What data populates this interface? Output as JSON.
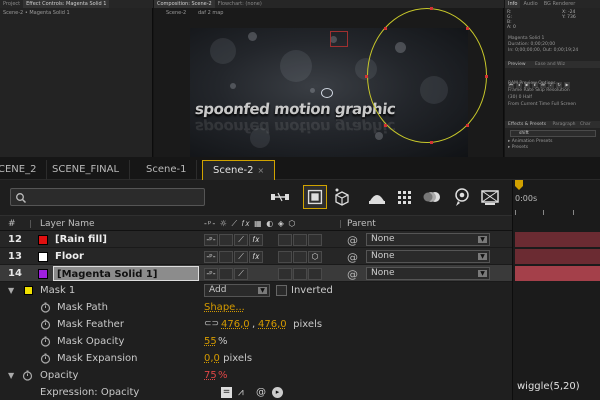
{
  "top": {
    "left_tabs": [
      "Project",
      "Effect Controls: Magenta Solid 1"
    ],
    "left_sub": "Scene-2 • Magenta Solid 1",
    "comp_tabs": [
      "Composition: Scene-2",
      "Flowchart: (none)"
    ],
    "comp_sub": [
      "Scene-2",
      "daf 2 map"
    ],
    "viewport_title": "spoonfed motion graphic",
    "right_tabs": [
      "Info",
      "Audio",
      "BG Renderer"
    ],
    "info_lines": [
      "R:",
      "G:",
      "B:",
      "A: 0",
      "X: -24",
      "Y: 736"
    ],
    "info_layer": [
      "Magenta Solid 1",
      "Duration: 0;00;20;00",
      "In: 0;00;00;00, Out: 0;00;19;24"
    ],
    "preview_tabs": [
      "Preview",
      "Ease and Wiz"
    ],
    "preview_lines": [
      "RAM Preview Options",
      "Frame Rate  Skip  Resolution",
      "(30)   0   Half",
      "From Current Time   Full Screen"
    ],
    "effects_tabs": [
      "Effects & Presets",
      "Paragraph",
      "Char"
    ],
    "effects_search": "shift",
    "effects_lines": [
      "▸ Animation Presets",
      "  ▸ Presets"
    ]
  },
  "tabs": [
    {
      "label": "CENE_2"
    },
    {
      "label": "SCENE_FINAL"
    },
    {
      "label": "Scene-1"
    },
    {
      "label": "Scene-2",
      "close": "×"
    }
  ],
  "search": {
    "value": ""
  },
  "columns": {
    "num": "#",
    "layer_name": "Layer Name",
    "parent": "Parent"
  },
  "layers": [
    {
      "num": "12",
      "name": "[Rain fill]",
      "color": "#e01010",
      "parent": "None",
      "selected": false
    },
    {
      "num": "13",
      "name": "Floor",
      "color": "#ffffff",
      "parent": "None",
      "selected": false
    },
    {
      "num": "14",
      "name": "[Magenta Solid 1]",
      "color": "#a020e0",
      "parent": "None",
      "selected": true
    }
  ],
  "mask": {
    "name": "Mask 1",
    "color": "#f0e000",
    "mode": "Add",
    "inverted_label": "Inverted",
    "props": [
      {
        "label": "Mask Path",
        "value": "Shape..."
      },
      {
        "label": "Mask Feather",
        "value_a": "476,0",
        "value_b": "476,0",
        "unit": " pixels"
      },
      {
        "label": "Mask Opacity",
        "value": "55",
        "unit": "%"
      },
      {
        "label": "Mask Expansion",
        "value": "0,0",
        "unit": " pixels"
      }
    ]
  },
  "opacity": {
    "label": "Opacity",
    "value": "75",
    "unit": "%"
  },
  "expression": {
    "label": "Expression: Opacity",
    "code": "wiggle(5,20)"
  },
  "timeline": {
    "ruler_label": "0:00s"
  }
}
